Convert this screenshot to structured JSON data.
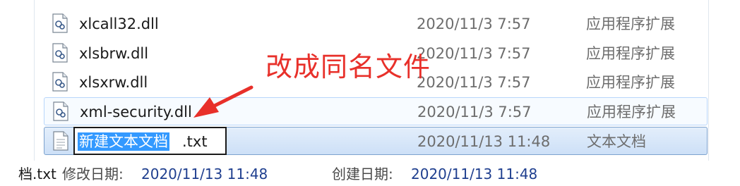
{
  "files": [
    {
      "name": "xlcall32.dll",
      "date": "2020/11/3 7:57",
      "type": "应用程序扩展",
      "icon": "dll-file-icon"
    },
    {
      "name": "xlsbrw.dll",
      "date": "2020/11/3 7:57",
      "type": "应用程序扩展",
      "icon": "dll-file-icon"
    },
    {
      "name": "xlsxrw.dll",
      "date": "2020/11/3 7:57",
      "type": "应用程序扩展",
      "icon": "dll-file-icon"
    },
    {
      "name": "xml-security.dll",
      "date": "2020/11/3 7:57",
      "type": "应用程序扩展",
      "icon": "dll-file-icon"
    },
    {
      "name_selected": "新建文本文档",
      "name_ext": ".txt",
      "date": "2020/11/13 11:48",
      "type": "文本文档",
      "icon": "text-file-icon"
    }
  ],
  "annotation": {
    "text": "改成同名文件",
    "color": "#e8302a"
  },
  "status_bar": {
    "file_name_tail": "档.txt",
    "modified_label": "修改日期:",
    "modified_value": "2020/11/13 11:48",
    "created_label": "创建日期:",
    "created_value": "2020/11/13 11:48"
  },
  "colors": {
    "selection": "#3399ff",
    "status_value": "#1f3f8f"
  }
}
